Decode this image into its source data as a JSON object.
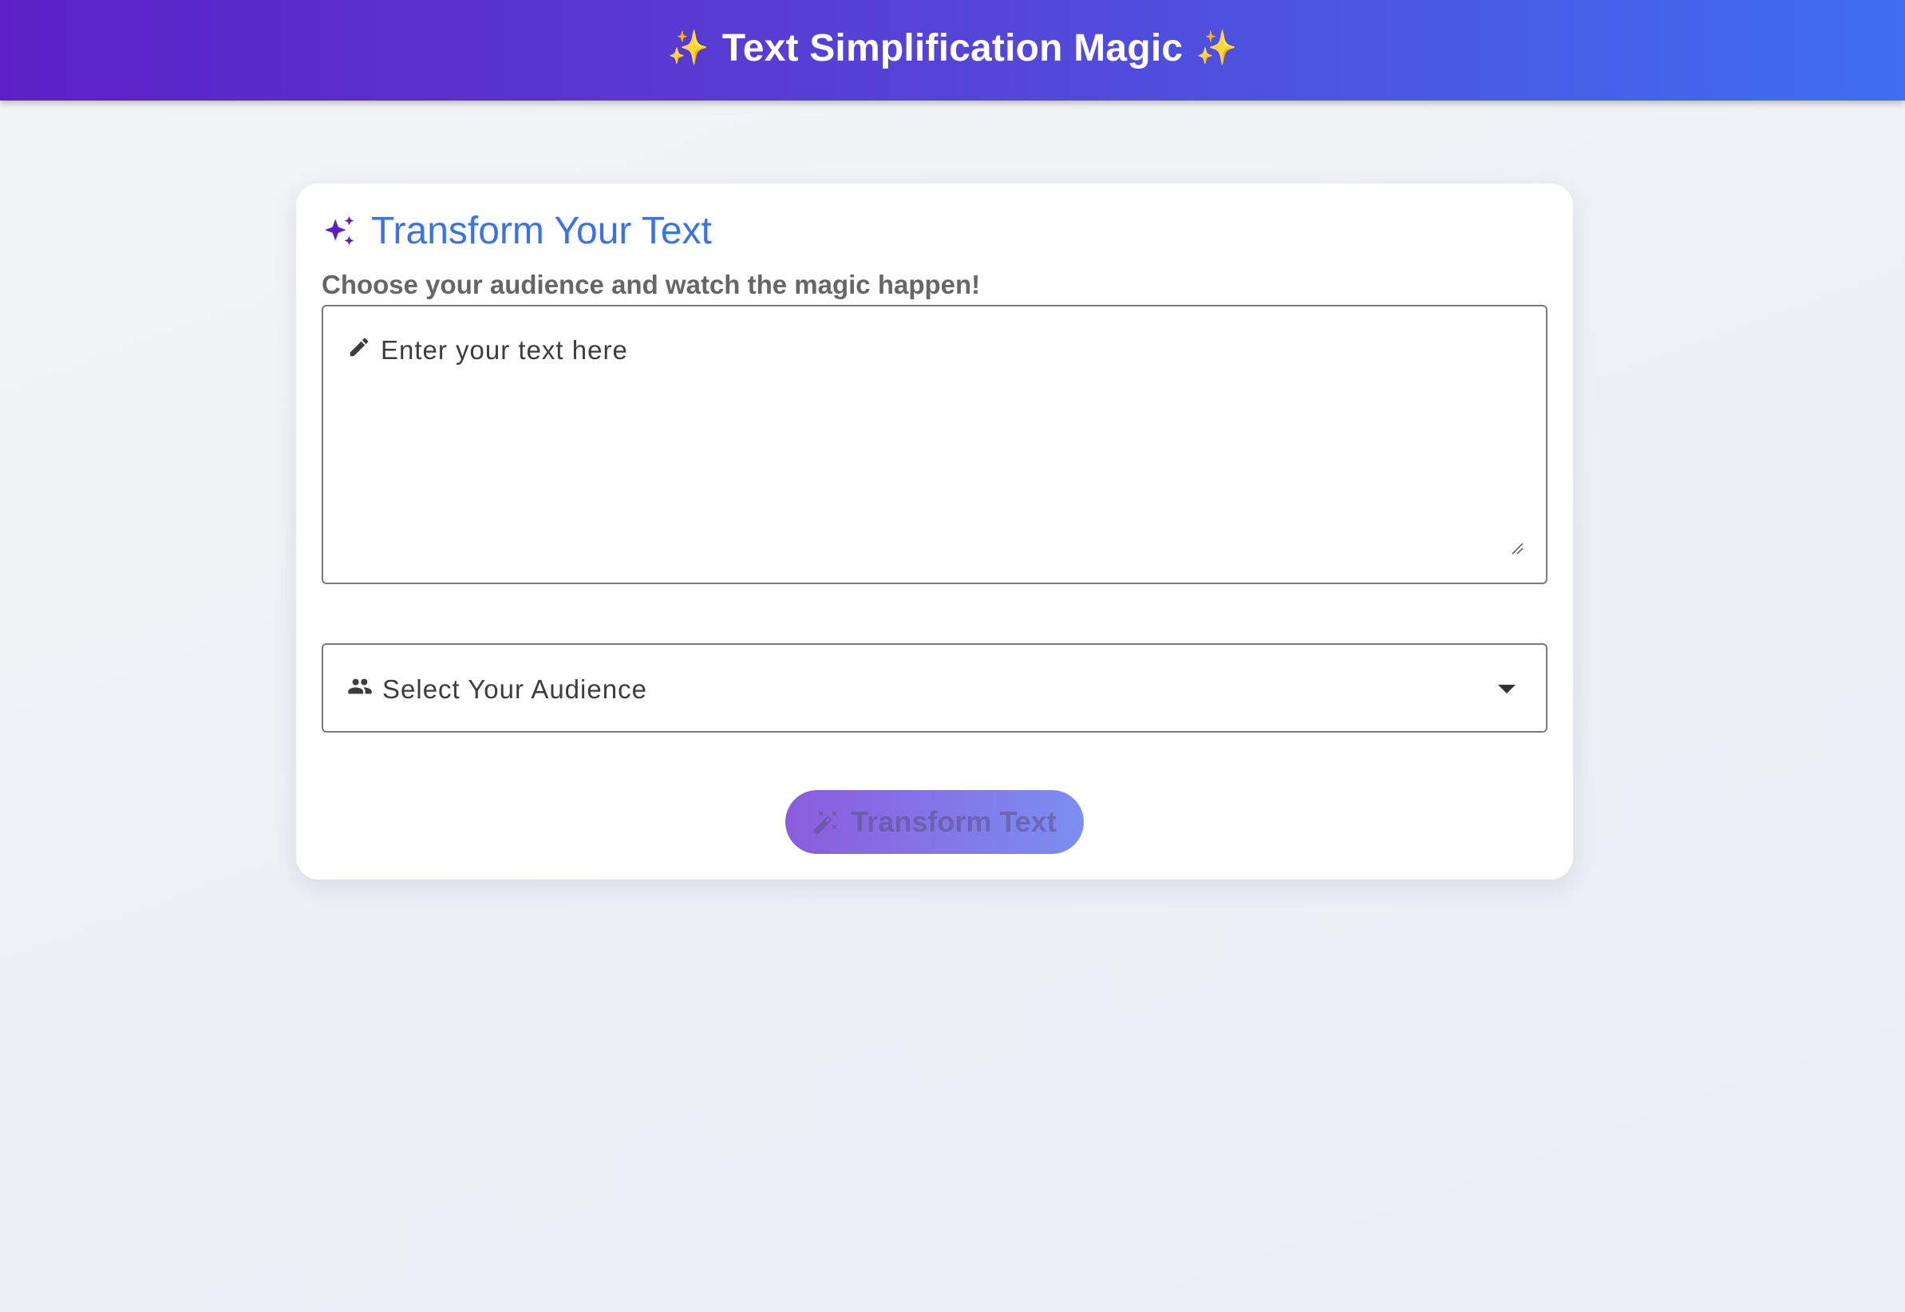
{
  "app_bar": {
    "sparkle_left": "✨",
    "title": "Text Simplification Magic",
    "sparkle_right": "✨",
    "gradient_start": "#5b21c6",
    "gradient_end": "#3f6ef0"
  },
  "card": {
    "icon": "auto-awesome-icon",
    "title": "Transform Your Text",
    "subtitle": "Choose your audience and watch the magic happen!"
  },
  "text_input": {
    "icon": "pencil-icon",
    "label": "Enter your text here",
    "value": ""
  },
  "audience_select": {
    "icon": "people-icon",
    "label": "Select Your Audience",
    "selected": ""
  },
  "transform_button": {
    "icon": "magic-wand-icon",
    "label": "Transform Text",
    "disabled": true
  },
  "colors": {
    "accent_blue": "#3b73e6",
    "accent_purple": "#5b21c6"
  }
}
